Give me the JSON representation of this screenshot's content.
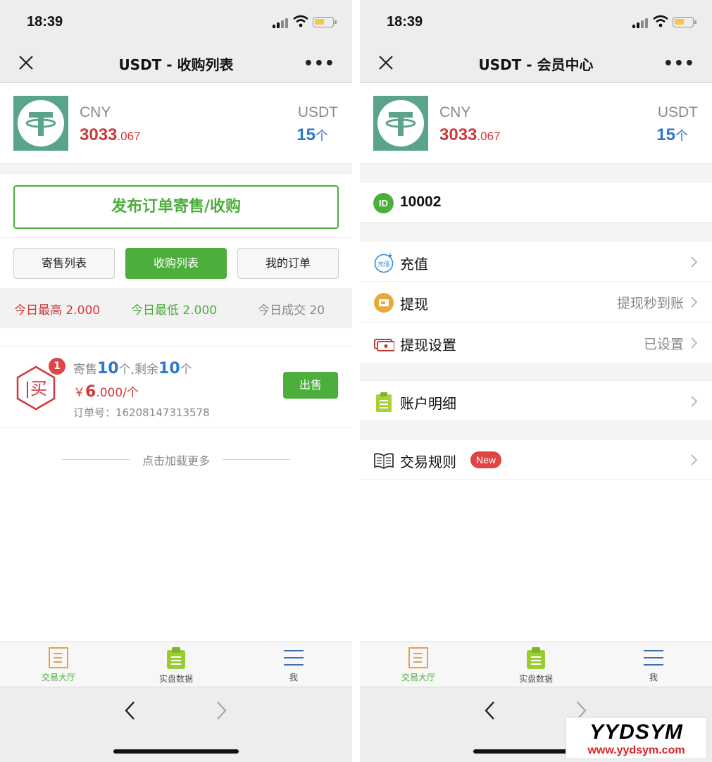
{
  "status": {
    "time": "18:39"
  },
  "left": {
    "nav_title": "USDT - 收购列表",
    "cny_label": "CNY",
    "cny_int": "3033",
    "cny_dec": ".067",
    "usdt_label": "USDT",
    "usdt_value": "15",
    "usdt_unit": "个",
    "publish_button": "发布订单寄售/收购",
    "tabs": [
      "寄售列表",
      "收购列表",
      "我的订单"
    ],
    "active_tab": 1,
    "stats": {
      "high": "今日最高 2.000",
      "low": "今日最低 2.000",
      "deal": "今日成交 20"
    },
    "order": {
      "badge": "1",
      "type_char": "买",
      "line1_a": "寄售",
      "line1_num1": "10",
      "line1_b": "个,剩余",
      "line1_num2": "10",
      "line1_c": "个",
      "price_symbol": "￥",
      "price_int": "6",
      "price_rest": ".000/个",
      "order_no": "订单号：16208147313578",
      "sell_button": "出售"
    },
    "load_more": "点击加载更多"
  },
  "right": {
    "nav_title": "USDT - 会员中心",
    "cny_label": "CNY",
    "cny_int": "3033",
    "cny_dec": ".067",
    "usdt_label": "USDT",
    "usdt_value": "15",
    "usdt_unit": "个",
    "id_icon": "ID",
    "member_id": "10002",
    "menu": {
      "recharge": {
        "label": "充值",
        "icon_text": "充值"
      },
      "withdraw": {
        "label": "提现",
        "value": "提现秒到账"
      },
      "withdraw_settings": {
        "label": "提现设置",
        "value": "已设置"
      },
      "account_details": {
        "label": "账户明细"
      },
      "trade_rules": {
        "label": "交易规则",
        "badge": "New"
      }
    }
  },
  "tabbar": [
    "交易大厅",
    "实盘数据",
    "我"
  ],
  "watermark": {
    "title": "YYDSYM",
    "url": "www.yydsym.com"
  },
  "colors": {
    "green": "#4cae3b",
    "red": "#d0393b",
    "blue": "#2f77c8",
    "tether": "#5aa58a"
  },
  "icons": [
    "close-icon",
    "more-icon",
    "tether-logo",
    "signal-icon",
    "wifi-icon",
    "battery-icon",
    "id-icon",
    "recharge-icon",
    "withdraw-icon",
    "card-icon",
    "clipboard-icon",
    "book-icon",
    "chevron-right-icon",
    "document-icon",
    "menu-lines-icon",
    "back-arrow-icon",
    "forward-arrow-icon"
  ]
}
